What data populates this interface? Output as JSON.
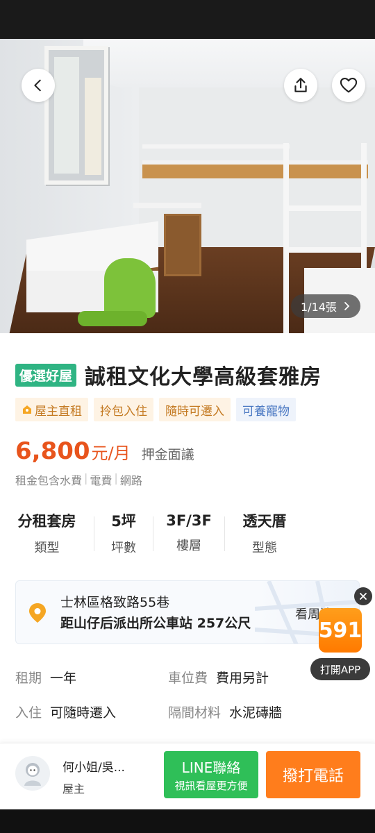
{
  "gallery": {
    "counter": "1/14張"
  },
  "listing": {
    "badge": "優選好屋",
    "title": "誠租文化大學高級套雅房",
    "tags": [
      "屋主直租",
      "拎包入住",
      "隨時可遷入",
      "可養寵物"
    ],
    "price": "6,800",
    "price_unit": "元/月",
    "deposit": "押金面議",
    "includes": [
      "租金包含水費",
      "電費",
      "網路"
    ]
  },
  "specs": [
    {
      "value": "分租套房",
      "label": "類型"
    },
    {
      "value": "5坪",
      "label": "坪數"
    },
    {
      "value": "3F/3F",
      "label": "樓層"
    },
    {
      "value": "透天厝",
      "label": "型態"
    }
  ],
  "address": {
    "street": "士林區格致路55巷",
    "nearby": "距山仔后派出所公車站 257公尺",
    "more": "看周邊"
  },
  "details": [
    {
      "key": "租期",
      "value": "一年"
    },
    {
      "key": "車位費",
      "value": "費用另計"
    },
    {
      "key": "入住",
      "value": "可隨時遷入"
    },
    {
      "key": "隔間材料",
      "value": "水泥磚牆"
    }
  ],
  "app_promo": {
    "logo": "591",
    "open": "打開APP"
  },
  "owner": {
    "name": "何小姐/吳...",
    "role": "屋主"
  },
  "actions": {
    "line_title": "LINE聯絡",
    "line_sub": "視訊看屋更方便",
    "call": "撥打電話"
  },
  "colors": {
    "price": "#e8541c",
    "badge": "#2fb483",
    "line": "#2fbf58",
    "call": "#ff7d1c"
  }
}
